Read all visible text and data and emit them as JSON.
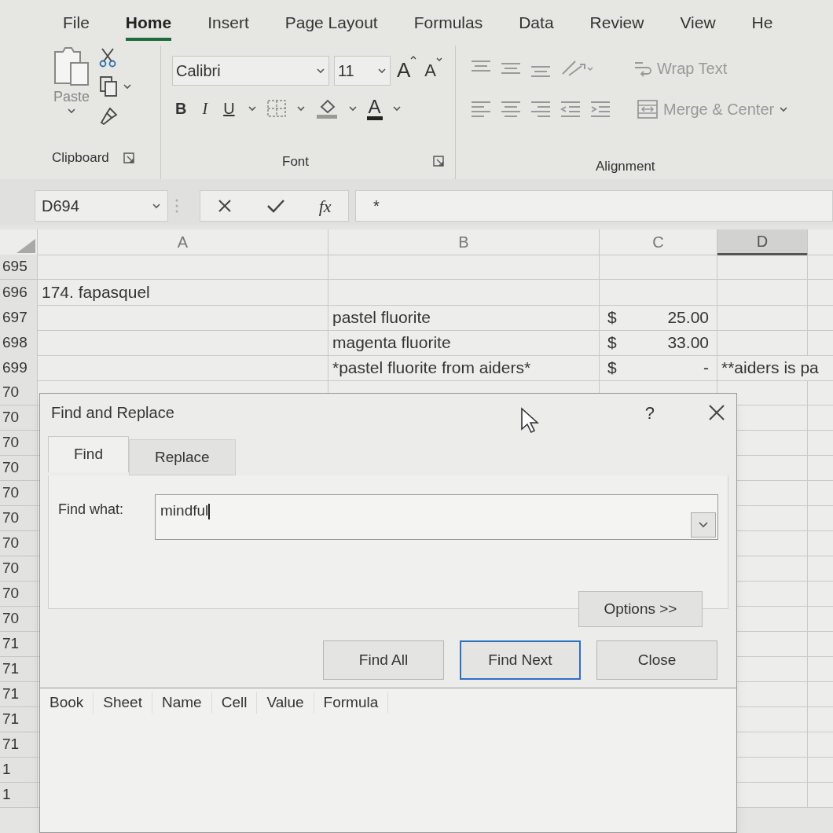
{
  "ribbon_tabs": [
    {
      "label": "File",
      "selected": false
    },
    {
      "label": "Home",
      "selected": true
    },
    {
      "label": "Insert",
      "selected": false
    },
    {
      "label": "Page Layout",
      "selected": false
    },
    {
      "label": "Formulas",
      "selected": false
    },
    {
      "label": "Data",
      "selected": false
    },
    {
      "label": "Review",
      "selected": false
    },
    {
      "label": "View",
      "selected": false
    },
    {
      "label": "He",
      "selected": false
    }
  ],
  "clipboard": {
    "paste_label": "Paste",
    "group_label": "Clipboard"
  },
  "font": {
    "name": "Calibri",
    "size": "11",
    "grow": "A",
    "shrink": "A",
    "bold": "B",
    "italic": "I",
    "underline": "U",
    "font_color": "A",
    "group_label": "Font"
  },
  "alignment": {
    "wrap_text": "Wrap Text",
    "merge_center": "Merge & Center",
    "group_label": "Alignment"
  },
  "formula_bar": {
    "name_box": "D694",
    "fx": "fx",
    "content": "*"
  },
  "columns": [
    {
      "label": "A",
      "selected": false
    },
    {
      "label": "B",
      "selected": false
    },
    {
      "label": "C",
      "selected": false
    },
    {
      "label": "D",
      "selected": true
    }
  ],
  "rows": [
    {
      "number": "695"
    },
    {
      "number": "696",
      "a": "174. fapasquel"
    },
    {
      "number": "697",
      "b": "pastel fluorite",
      "c_symbol": "$",
      "c_value": "25.00"
    },
    {
      "number": "698",
      "b": "magenta fluorite",
      "c_symbol": "$",
      "c_value": "33.00"
    },
    {
      "number": "699",
      "b": "*pastel fluorite from aiders*",
      "c_symbol": "$",
      "c_value": "-",
      "d": "**aiders is pa"
    },
    {
      "number": "70"
    },
    {
      "number": "70"
    },
    {
      "number": "70"
    },
    {
      "number": "70"
    },
    {
      "number": "70"
    },
    {
      "number": "70"
    },
    {
      "number": "70"
    },
    {
      "number": "70"
    },
    {
      "number": "70"
    },
    {
      "number": "70"
    },
    {
      "number": "71"
    },
    {
      "number": "71"
    },
    {
      "number": "71"
    },
    {
      "number": "71"
    },
    {
      "number": "71"
    },
    {
      "number": "1"
    },
    {
      "number": "1"
    }
  ],
  "dialog": {
    "title": "Find and Replace",
    "help": "?",
    "tabs": [
      {
        "label": "Find",
        "selected": true
      },
      {
        "label": "Replace",
        "selected": false
      }
    ],
    "find_what_label": "Find what:",
    "find_what_value": "mindful",
    "options_button": "Options >>",
    "buttons": [
      {
        "label": "Find All",
        "focused": false
      },
      {
        "label": "Find Next",
        "focused": true
      },
      {
        "label": "Close",
        "focused": false
      }
    ],
    "result_columns": [
      "Book",
      "Sheet",
      "Name",
      "Cell",
      "Value",
      "Formula"
    ]
  }
}
